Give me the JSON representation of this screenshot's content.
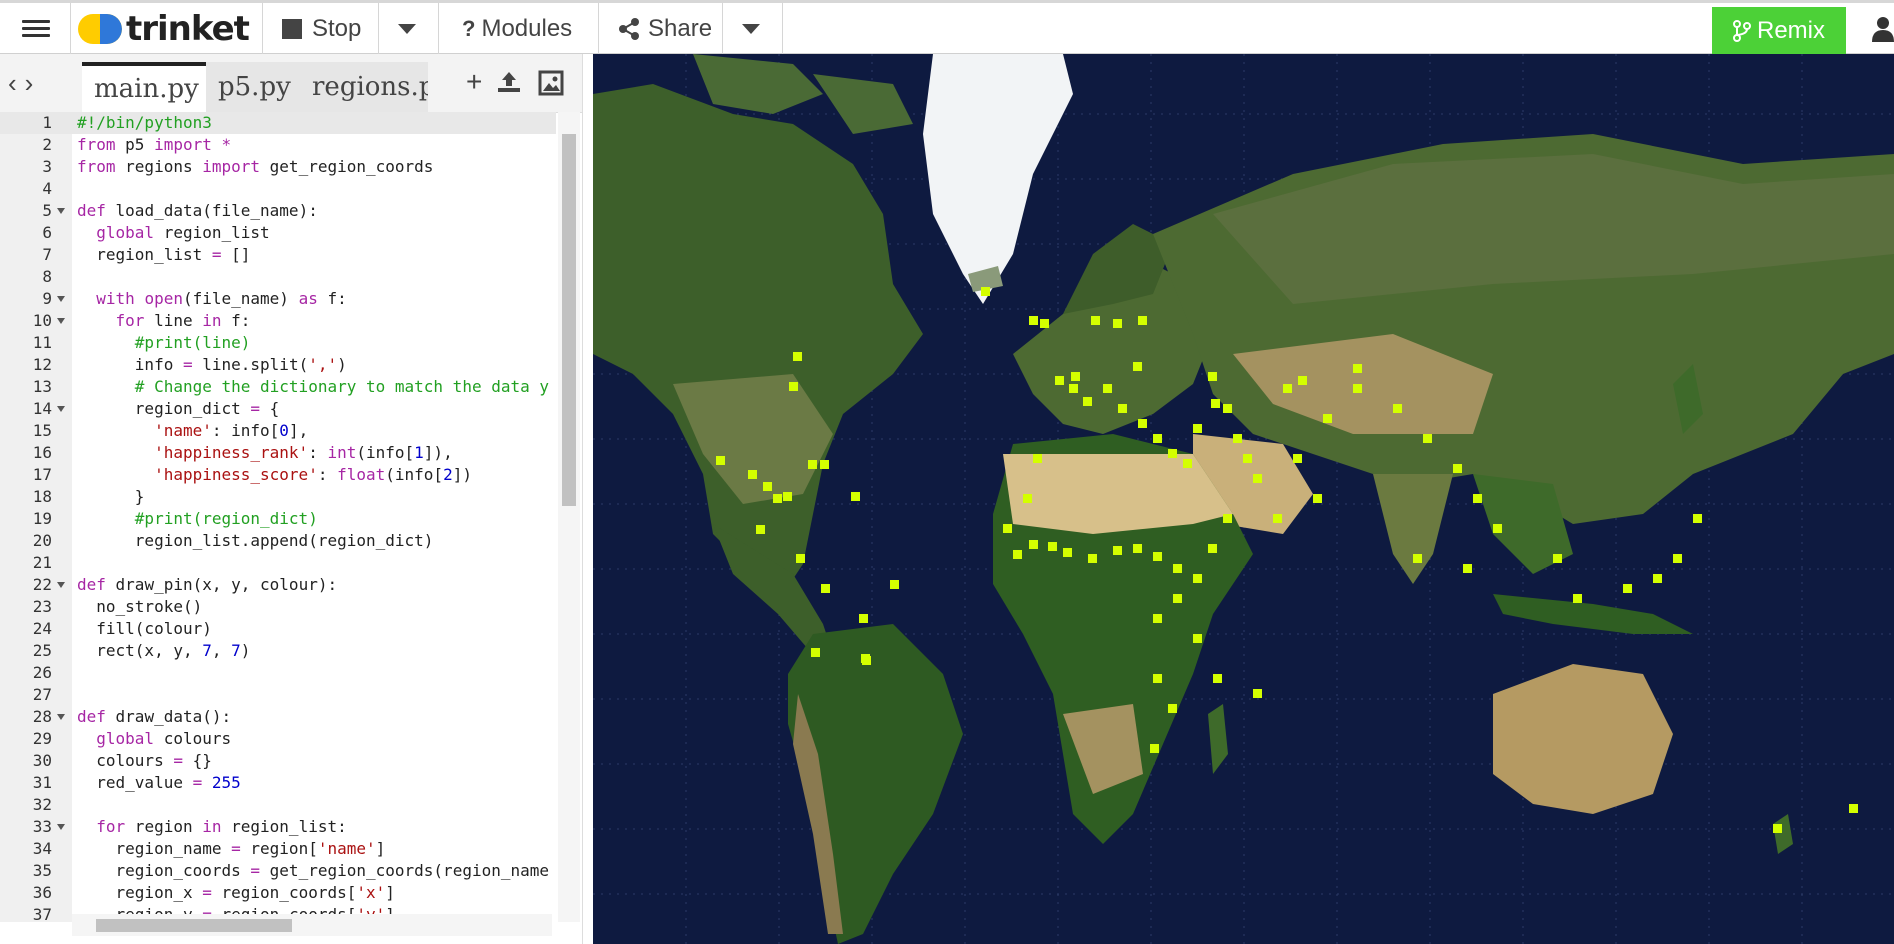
{
  "header": {
    "logo_text": "trinket",
    "stop_label": "Stop",
    "modules_label": "Modules",
    "share_label": "Share",
    "remix_label": "Remix"
  },
  "editor": {
    "tabs": [
      "main.py",
      "p5.py",
      "regions.py"
    ],
    "lines": [
      "#!/bin/python3",
      "from p5 import *",
      "from regions import get_region_coords",
      "",
      "def load_data(file_name):",
      "  global region_list",
      "  region_list = []",
      "",
      "  with open(file_name) as f:",
      "    for line in f:",
      "      #print(line)",
      "      info = line.split(',')",
      "      # Change the dictionary to match the data y",
      "      region_dict = {",
      "        'name': info[0],",
      "        'happiness_rank': int(info[1]),",
      "        'happiness_score': float(info[2])",
      "      }",
      "      #print(region_dict)",
      "      region_list.append(region_dict)",
      "",
      "def draw_pin(x, y, colour):",
      "  no_stroke()",
      "  fill(colour)",
      "  rect(x, y, 7, 7)",
      "",
      "",
      "def draw_data():",
      "  global colours",
      "  colours = {}",
      "  red_value = 255",
      "",
      "  for region in region_list:",
      "    region_name = region['name']",
      "    region_coords = get_region_coords(region_name",
      "    region_x = region_coords['x']",
      "    region_y = region_coords['y']",
      ""
    ]
  },
  "colors": {
    "remix_green": "#4cd137",
    "ocean": "#0e1a40",
    "land": "#3d5f2a",
    "desert": "#c9b07a",
    "ice": "#f2f4f6",
    "pin": "#d4ff00"
  }
}
